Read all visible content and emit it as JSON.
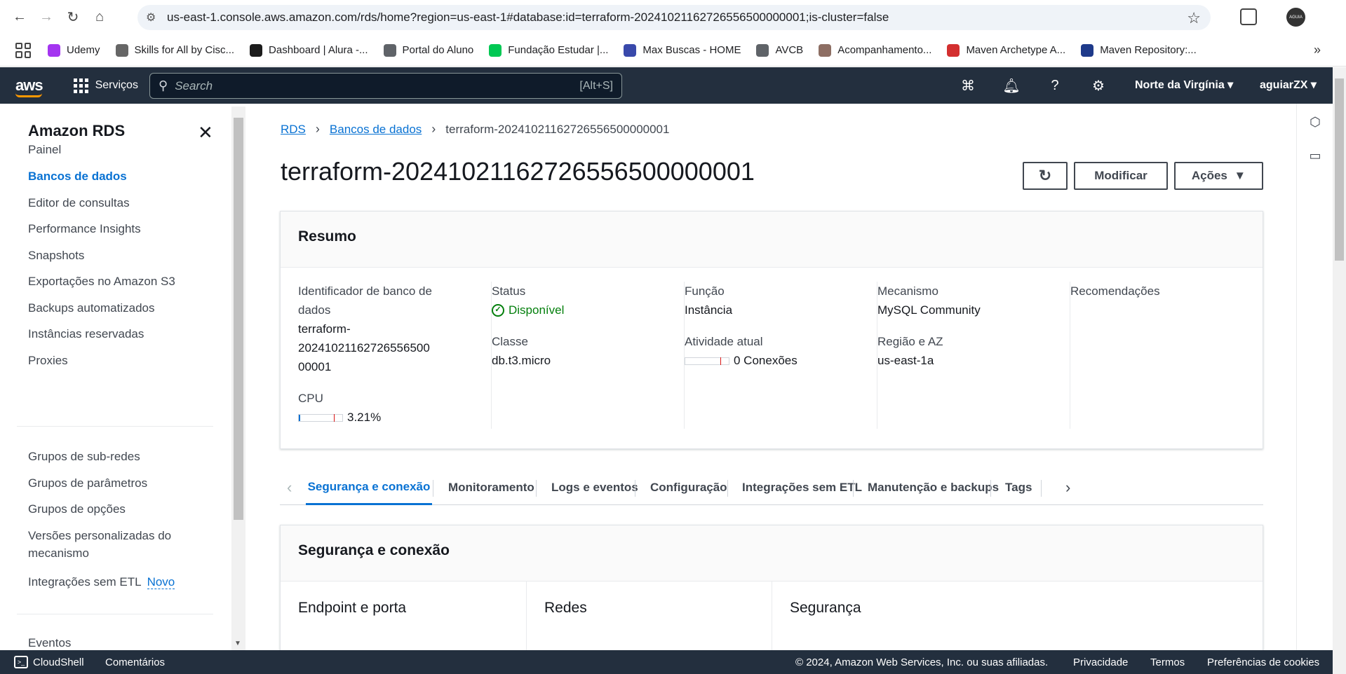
{
  "browser": {
    "url": "us-east-1.console.aws.amazon.com/rds/home?region=us-east-1#database:id=terraform-20241021162726556500000001;is-cluster=false",
    "bookmarks": [
      {
        "label": "Udemy",
        "icon": "udemy-icon",
        "color": "#a435f0"
      },
      {
        "label": "Skills for All by Cisc...",
        "icon": "cisco-icon",
        "color": "#666666"
      },
      {
        "label": "Dashboard | Alura -...",
        "icon": "alura-icon",
        "color": "#1c1c1c"
      },
      {
        "label": "Portal do Aluno",
        "icon": "globe-icon",
        "color": "#5f6368"
      },
      {
        "label": "Fundação Estudar |...",
        "icon": "estudar-icon",
        "color": "#00c853"
      },
      {
        "label": "Max Buscas - HOME",
        "icon": "search-icon",
        "color": "#3949ab"
      },
      {
        "label": "AVCB",
        "icon": "globe-icon",
        "color": "#5f6368"
      },
      {
        "label": "Acompanhamento...",
        "icon": "school-icon",
        "color": "#8d6e63"
      },
      {
        "label": "Maven Archetype A...",
        "icon": "feather-icon",
        "color": "#d32f2f"
      },
      {
        "label": "Maven Repository:...",
        "icon": "mvn-icon",
        "color": "#1e3a8a"
      }
    ]
  },
  "aws_nav": {
    "logo": "aws",
    "services": "Serviços",
    "search_placeholder": "Search",
    "search_shortcut": "[Alt+S]",
    "region": "Norte da Virgínia",
    "account": "aguiarZX"
  },
  "sidebar": {
    "title": "Amazon RDS",
    "items": [
      {
        "label": "Painel",
        "active": false
      },
      {
        "label": "Bancos de dados",
        "active": true
      },
      {
        "label": "Editor de consultas",
        "active": false
      },
      {
        "label": "Performance Insights",
        "active": false
      },
      {
        "label": "Snapshots",
        "active": false
      },
      {
        "label": "Exportações no Amazon S3",
        "active": false
      },
      {
        "label": "Backups automatizados",
        "active": false
      },
      {
        "label": "Instâncias reservadas",
        "active": false
      },
      {
        "label": "Proxies",
        "active": false
      }
    ],
    "items2": [
      {
        "label": "Grupos de sub-redes"
      },
      {
        "label": "Grupos de parâmetros"
      },
      {
        "label": "Grupos de opções"
      },
      {
        "label": "Versões personalizadas do"
      },
      {
        "label": "mecanismo"
      },
      {
        "label": "Integrações sem ETL"
      }
    ],
    "novo_badge": "Novo",
    "items3": [
      {
        "label": "Eventos"
      }
    ]
  },
  "breadcrumb": {
    "rds": "RDS",
    "databases": "Bancos de dados",
    "current": "terraform-20241021162726556500000001"
  },
  "page": {
    "title": "terraform-20241021162726556500000001",
    "modify_label": "Modificar",
    "actions_label": "Ações"
  },
  "summary": {
    "heading": "Resumo",
    "identifier_label_1": "Identificador de banco de",
    "identifier_label_2": "dados",
    "identifier_value_1": "terraform-",
    "identifier_value_2": "20241021162726556500",
    "identifier_value_3": "00001",
    "cpu_label": "CPU",
    "cpu_value": "3.21%",
    "cpu_fraction": 0.0321,
    "status_label": "Status",
    "status_value": "Disponível",
    "class_label": "Classe",
    "class_value": "db.t3.micro",
    "role_label": "Função",
    "role_value": "Instância",
    "activity_label": "Atividade atual",
    "activity_value": "0 Conexões",
    "engine_label": "Mecanismo",
    "engine_value": "MySQL Community",
    "region_label": "Região e AZ",
    "region_value": "us-east-1a",
    "recommendations_label": "Recomendações"
  },
  "tabs": [
    {
      "label": "Segurança e conexão",
      "active": true
    },
    {
      "label": "Monitoramento"
    },
    {
      "label": "Logs e eventos"
    },
    {
      "label": "Configuração"
    },
    {
      "label": "Integrações sem ETL"
    },
    {
      "label": "Manutenção e backups"
    },
    {
      "label": "Tags"
    }
  ],
  "security": {
    "heading": "Segurança e conexão",
    "endpoint_heading": "Endpoint e porta",
    "networks_heading": "Redes",
    "security_heading": "Segurança"
  },
  "footer": {
    "cloudshell": "CloudShell",
    "comments": "Comentários",
    "copyright": "© 2024, Amazon Web Services, Inc. ou suas afiliadas.",
    "privacy": "Privacidade",
    "terms": "Termos",
    "cookies": "Preferências de cookies"
  },
  "colors": {
    "aws_nav_bg": "#232f3e",
    "link": "#0972d3",
    "success": "#037f0c"
  }
}
